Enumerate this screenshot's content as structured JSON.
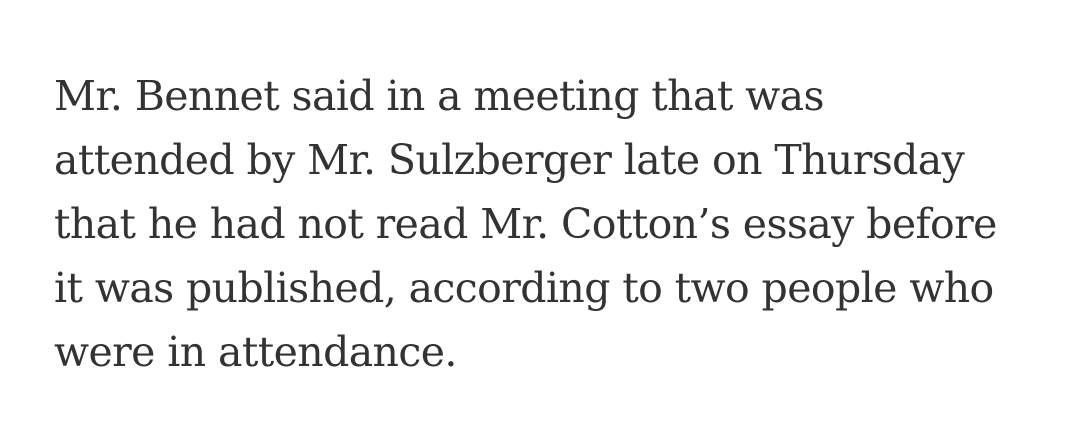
{
  "article": {
    "lines": [
      "Mr. Bennet said in a meeting that was",
      "attended by Mr. Sulzberger late on Thursday",
      "that he had not read Mr. Cotton’s essay before",
      "it was published, according to two people who",
      "were in attendance."
    ]
  },
  "colors": {
    "text": "#333333",
    "background": "#ffffff"
  }
}
